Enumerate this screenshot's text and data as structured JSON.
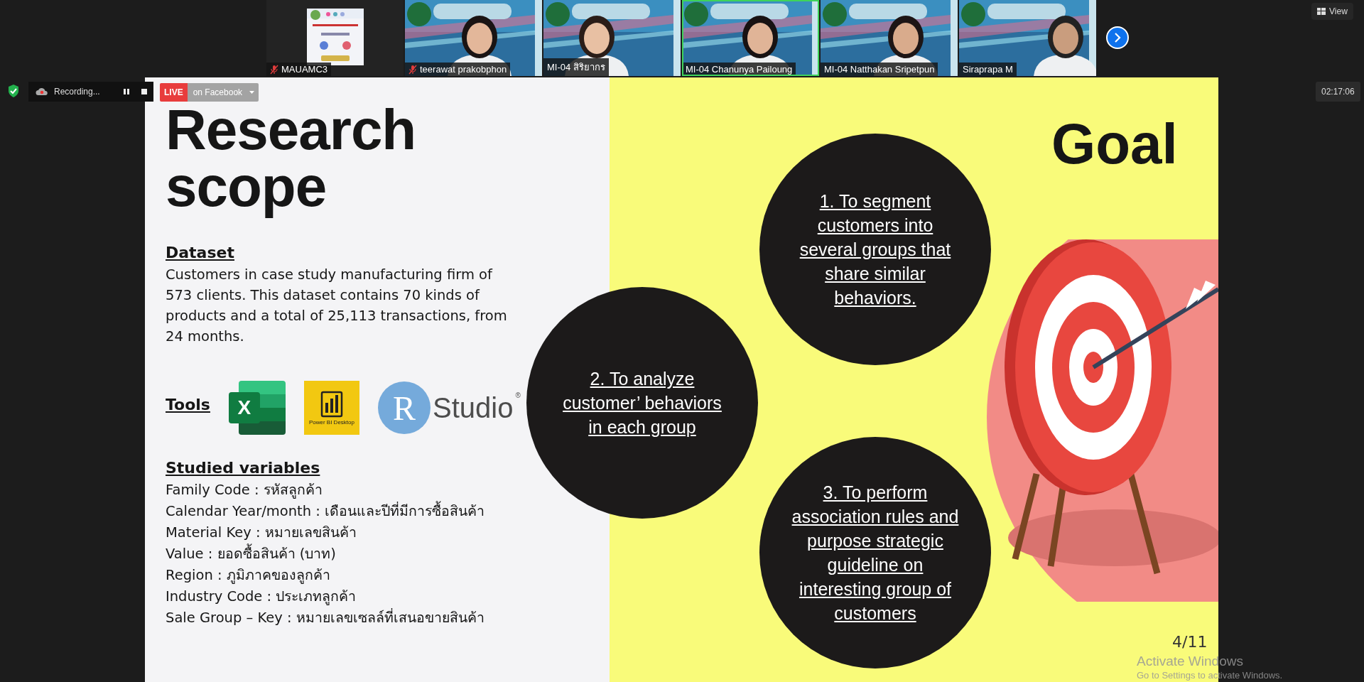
{
  "gallery": {
    "tiles": [
      {
        "kind": "poster",
        "name": "MAUAMC3",
        "muted": true,
        "speaking": false
      },
      {
        "kind": "video",
        "name": "teerawat prakobphon",
        "muted": true,
        "speaking": false
      },
      {
        "kind": "video",
        "name": "MI-04 สิริยากร",
        "muted": false,
        "speaking": false
      },
      {
        "kind": "video",
        "name": "MI-04 Chanunya Pailoung",
        "muted": false,
        "speaking": true
      },
      {
        "kind": "video",
        "name": "MI-04 Natthakan Sripetpun",
        "muted": false,
        "speaking": false
      },
      {
        "kind": "video",
        "name": "Siraprapa M",
        "muted": false,
        "speaking": false
      }
    ],
    "view_button": "View"
  },
  "controls": {
    "recording": "Recording...",
    "live_badge": "LIVE",
    "live_target": "on Facebook",
    "timer": "02:17:06"
  },
  "slide": {
    "title": "Research scope",
    "sections": [
      {
        "kind": "text",
        "heading": "Dataset",
        "body": "Customers in case study manufacturing firm of 573 clients. This dataset contains 70 kinds of products and a total of 25,113 transactions, from 24 months."
      },
      {
        "kind": "logos",
        "heading": "Tools",
        "logos": [
          {
            "kind": "excel",
            "text": "X"
          },
          {
            "kind": "powerbi",
            "text": "Power BI Desktop"
          },
          {
            "kind": "rstudio",
            "mark": "R",
            "text": "Studio",
            "sup": "®"
          }
        ]
      },
      {
        "kind": "list",
        "heading": "Studied variables",
        "items": [
          "Family Code : รหัสลูกค้า",
          "Calendar Year/month : เดือนและปีที่มีการซื้อสินค้า",
          "Material Key : หมายเลขสินค้า",
          "Value : ยอดซื้อสินค้า (บาท)",
          "Region : ภูมิภาคของลูกค้า",
          "Industry Code : ประเภทลูกค้า",
          "Sale Group – Key : หมายเลขเซลล์ที่เสนอขายสินค้า"
        ]
      }
    ],
    "goal_title": "Goal",
    "objectives": [
      "1. To segment customers into several groups that share similar behaviors.",
      "2. To analyze customer’ behaviors in each group",
      "3. To perform association rules and purpose strategic guideline on interesting group of customers"
    ],
    "page_number": "4/11"
  },
  "os_notice": {
    "title": "Activate Windows",
    "body": "Go to Settings to activate Windows."
  }
}
